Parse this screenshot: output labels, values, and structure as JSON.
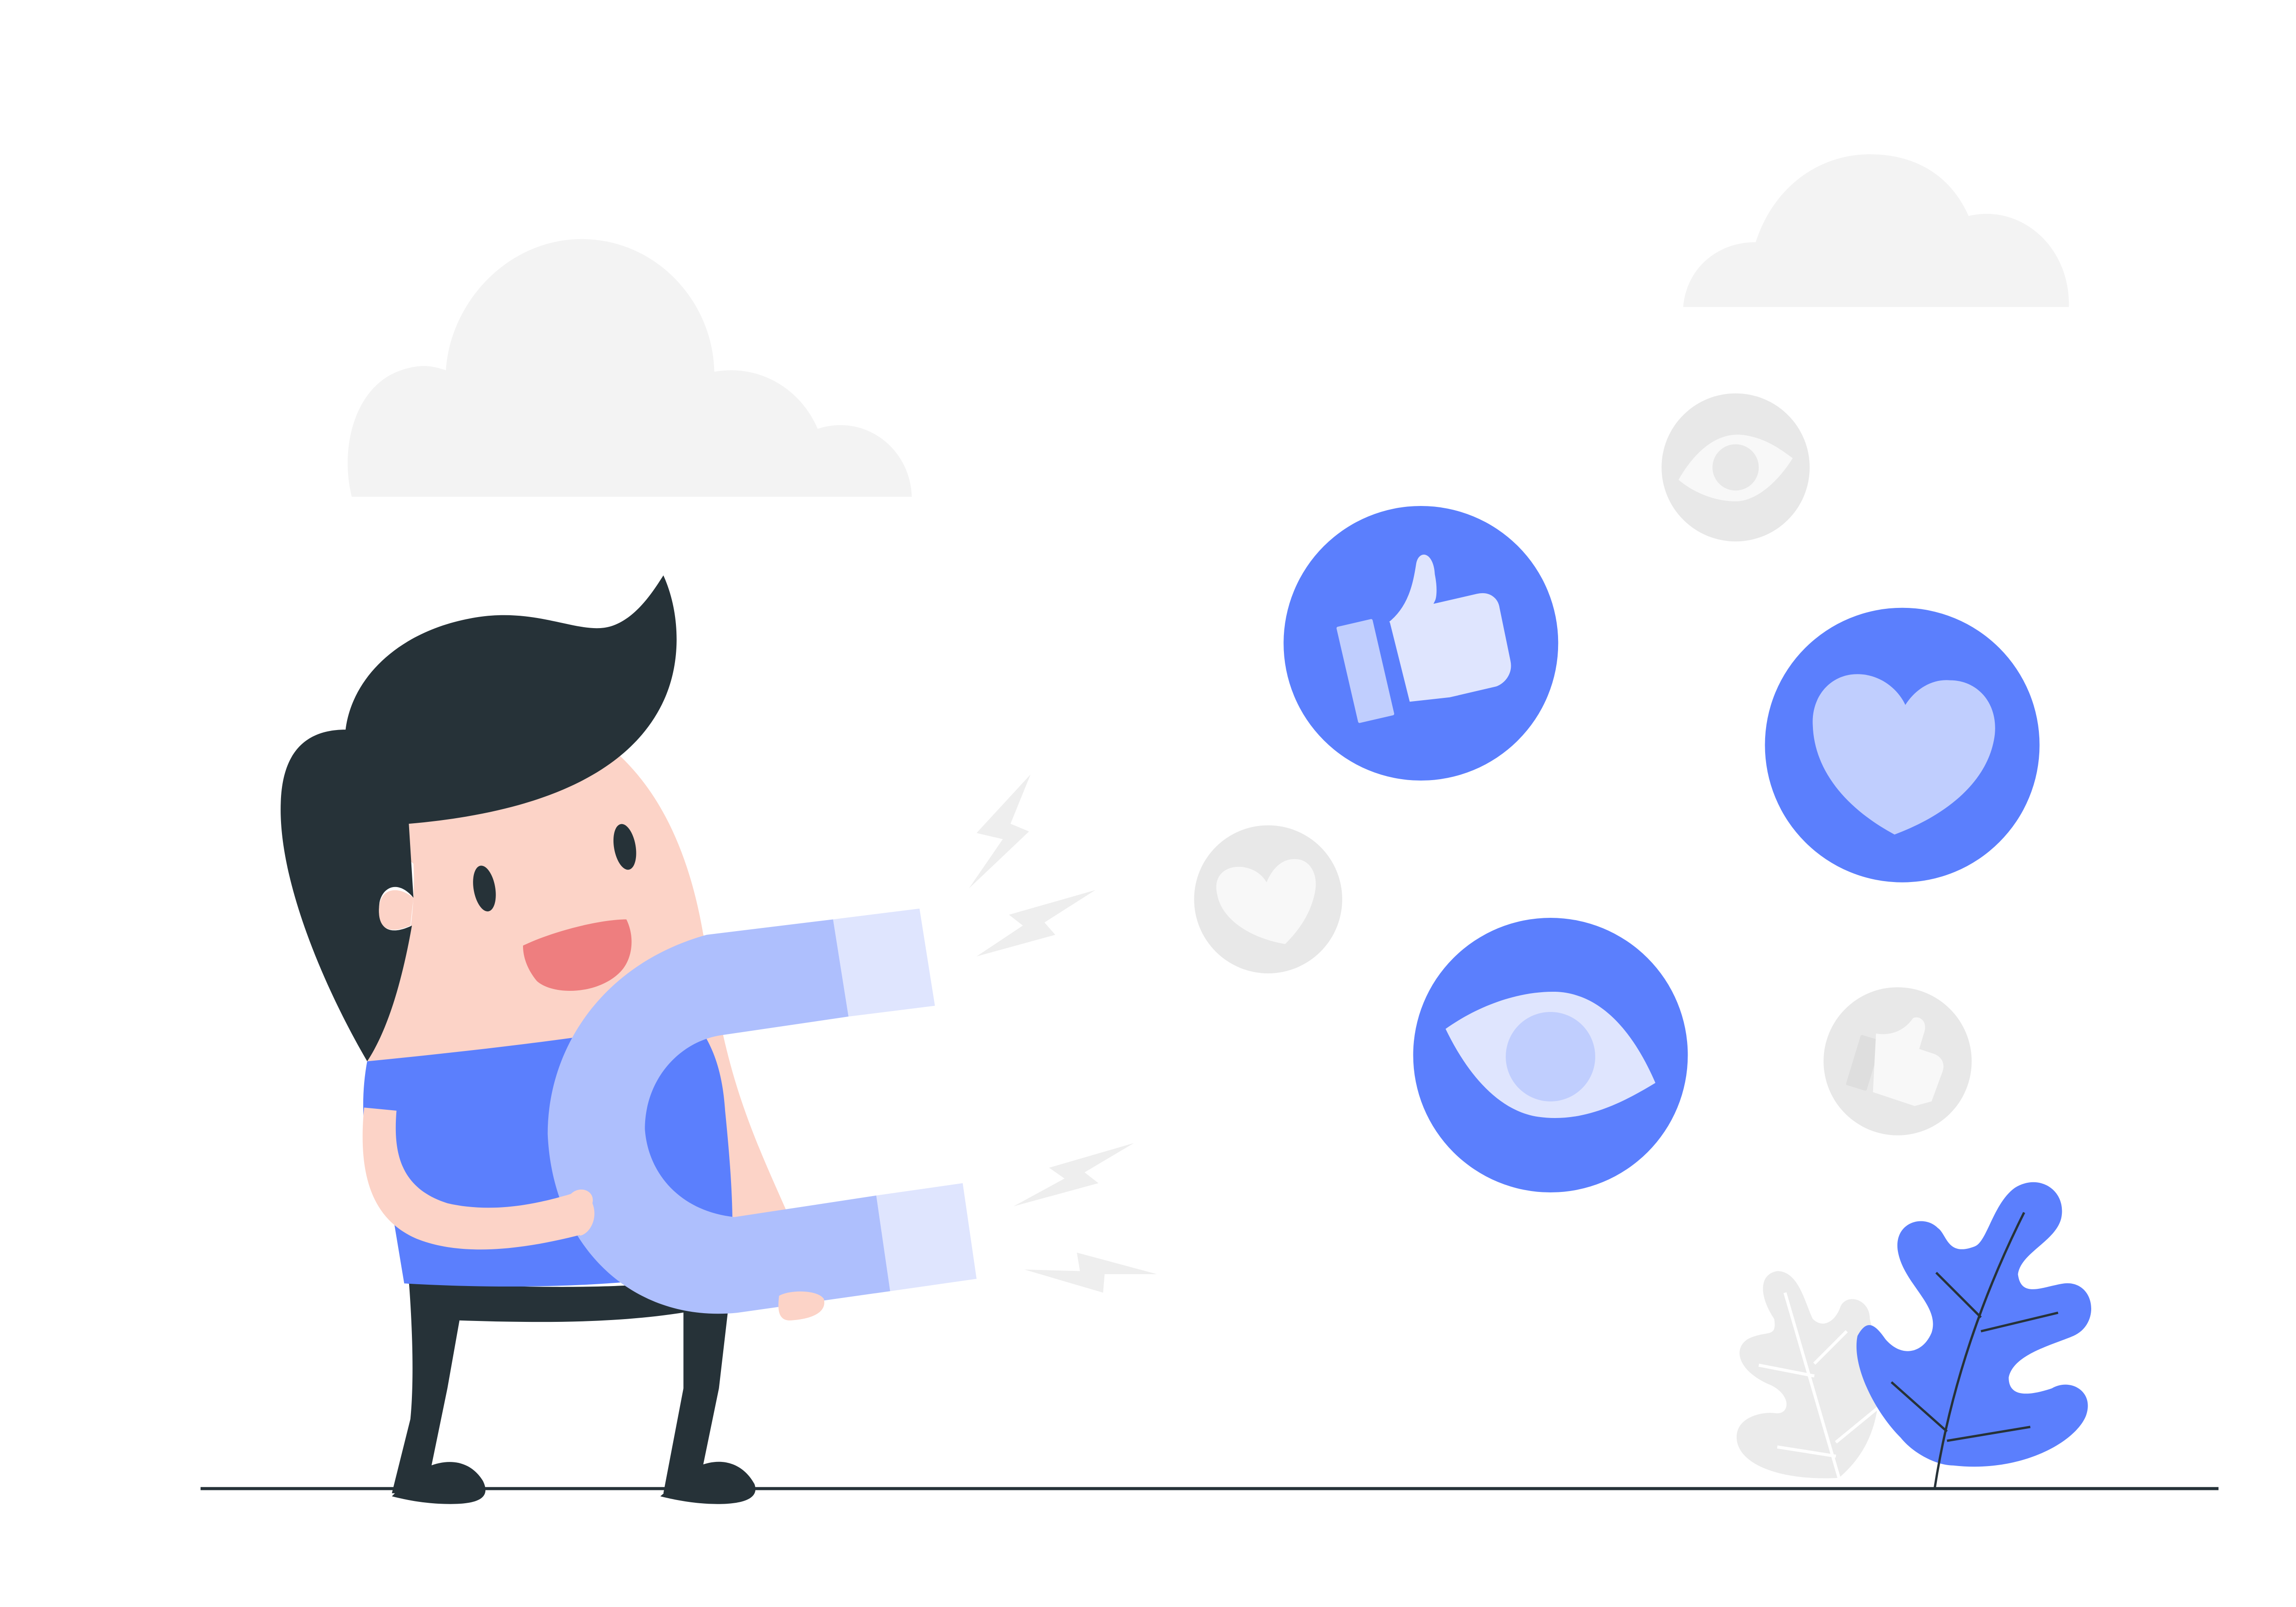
{
  "palette": {
    "background": "#ffffff",
    "cloud": "#f3f3f3",
    "accent_blue": "#5b7ffd",
    "magnet_body": "#aebffd",
    "magnet_tip": "#dfe5fe",
    "icon_light": "#dfe5fe",
    "icon_mid": "#c0cefe",
    "skin": "#fcd3c7",
    "mouth": "#ee7e7f",
    "hair": "#263238",
    "faded_circle": "#e8e8e8",
    "faded_icon": "#f8f8f8",
    "sparks": "#eeeeee",
    "ground_line": "#263238"
  },
  "icons": [
    "thumbs-up-icon",
    "heart-icon",
    "eye-icon",
    "faded-heart-icon",
    "faded-eye-icon",
    "faded-thumbs-up-icon"
  ]
}
